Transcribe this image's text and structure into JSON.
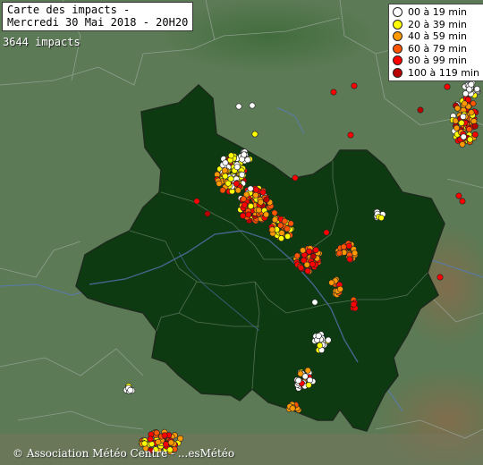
{
  "title": {
    "line1": "Carte des impacts -",
    "line2": "Mercredi 30 Mai 2018 - 20H20"
  },
  "impact_count": "3644 impacts",
  "legend": [
    {
      "label": "00 à 19 min",
      "color": "#ffffff"
    },
    {
      "label": "20 à 39 min",
      "color": "#ffff00"
    },
    {
      "label": "40 à 59 min",
      "color": "#ff9900"
    },
    {
      "label": "60 à 79 min",
      "color": "#ff5500"
    },
    {
      "label": "80 à 99 min",
      "color": "#ff0000"
    },
    {
      "label": "100 à 119 min",
      "color": "#bb0000"
    }
  ],
  "credit": "© Association Météo Centre - ...esMétéo",
  "colors": {
    "terrain": "#5b7a55",
    "region": "#0e3a12",
    "borders": "#9aa89a",
    "rivers": "#5a7aa8"
  }
}
